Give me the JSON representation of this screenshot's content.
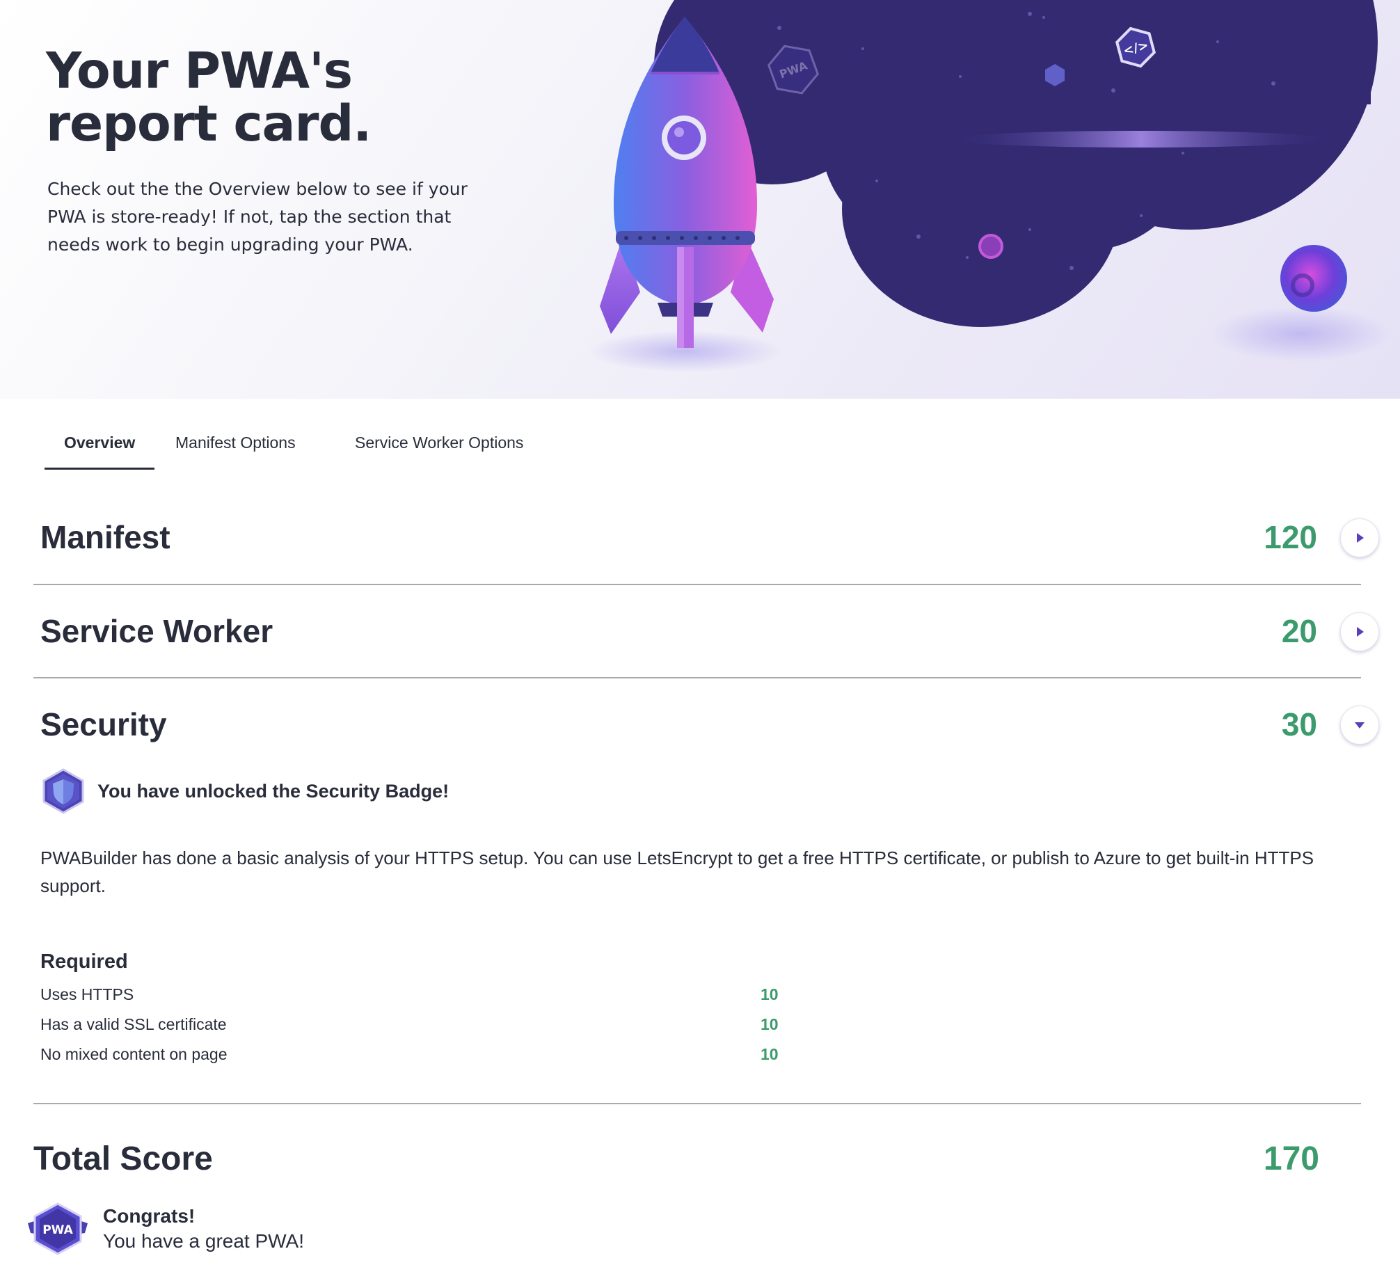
{
  "hero": {
    "title": "Your PWA's report card.",
    "description": "Check out the the Overview below to see if your PWA is store-ready! If not, tap the section that needs work to begin upgrading your PWA.",
    "badge_text": "PWA"
  },
  "tabs": [
    {
      "label": "Overview",
      "active": true
    },
    {
      "label": "Manifest Options",
      "active": false
    },
    {
      "label": "Service Worker Options",
      "active": false
    }
  ],
  "sections": [
    {
      "title": "Manifest",
      "score": "120",
      "expanded": false,
      "toggle_icon": "chevron-right-icon"
    },
    {
      "title": "Service Worker",
      "score": "20",
      "expanded": false,
      "toggle_icon": "chevron-right-icon"
    },
    {
      "title": "Security",
      "score": "30",
      "expanded": true,
      "toggle_icon": "chevron-down-icon"
    }
  ],
  "security": {
    "badge_icon": "shield-badge-icon",
    "badge_text": "You have unlocked the Security Badge!",
    "description": "PWABuilder has done a basic analysis of your HTTPS setup. You can use LetsEncrypt to get a free HTTPS certificate, or publish to Azure to get built-in HTTPS support.",
    "required_heading": "Required",
    "required_items": [
      {
        "label": "Uses HTTPS",
        "value": "10"
      },
      {
        "label": "Has a valid SSL certificate",
        "value": "10"
      },
      {
        "label": "No mixed content on page",
        "value": "10"
      }
    ]
  },
  "total": {
    "title": "Total Score",
    "score": "170",
    "badge_icon": "pwa-badge-icon",
    "badge_text": "PWA",
    "congrats_title": "Congrats!",
    "congrats_sub": "You have a great PWA!"
  },
  "colors": {
    "text": "#292c3a",
    "score_green": "#3c9b6c",
    "accent_purple": "#5b3eb8",
    "divider": "#a9a9ad"
  }
}
